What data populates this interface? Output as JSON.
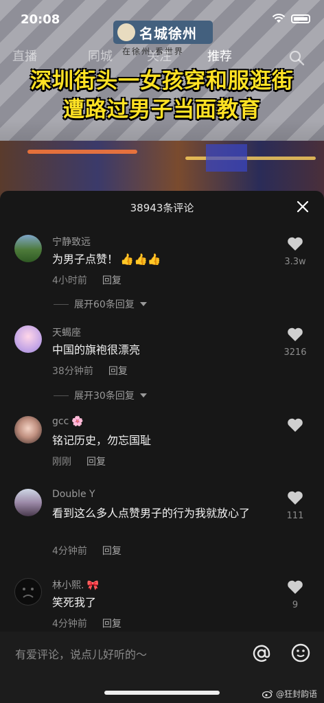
{
  "status": {
    "time": "20:08"
  },
  "logo": {
    "title": "名城徐州",
    "subtitle": "在徐州·看世界"
  },
  "nav": {
    "tabs": [
      {
        "label": "直播"
      },
      {
        "label": "同城"
      },
      {
        "label": "关注"
      },
      {
        "label": "推荐"
      }
    ]
  },
  "headline": {
    "line1": "深圳街头一女孩穿和服逛街",
    "line2": "遭路过男子当面教育"
  },
  "panel": {
    "title": "38943条评论"
  },
  "comments": [
    {
      "name": "宁静致远",
      "text": "为男子点赞！",
      "emoji": "👍👍👍",
      "time": "4小时前",
      "reply": "回复",
      "likes": "3.3w",
      "expand": "展开60条回复"
    },
    {
      "name": "天蝎座",
      "text": "中国的旗袍很漂亮",
      "time": "38分钟前",
      "reply": "回复",
      "likes": "3216",
      "expand": "展开30条回复"
    },
    {
      "name": "gcc",
      "name_emoji": "🌸",
      "text": "铭记历史，勿忘国耻",
      "time": "刚刚",
      "reply": "回复",
      "likes": ""
    },
    {
      "name": "Double Y",
      "text": "看到这么多人点赞男子的行为我就放心了",
      "time": "4分钟前",
      "reply": "回复",
      "likes": "111"
    },
    {
      "name": "林小熙.",
      "name_emoji": "🎀",
      "text": "笑死我了",
      "time": "4分钟前",
      "reply": "回复",
      "likes": "9"
    }
  ],
  "input": {
    "placeholder": "有爱评论，说点儿好听的～"
  },
  "watermark": {
    "text": "@狂封韵语"
  },
  "colors": {
    "headline": "#ffe224",
    "panel_bg": "#171717",
    "heart": "#cfcfcf"
  }
}
